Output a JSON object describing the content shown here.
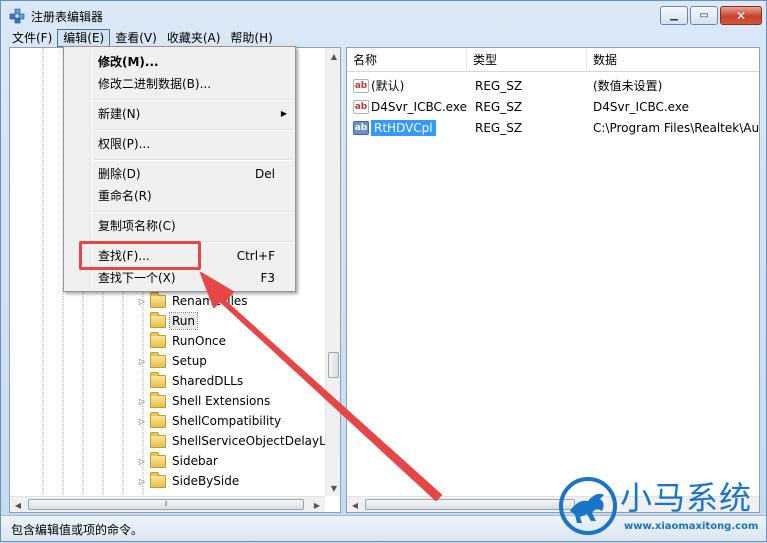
{
  "window": {
    "title": "注册表编辑器",
    "min_icon": "minimize-icon",
    "max_icon": "maximize-icon",
    "close_icon": "close-icon"
  },
  "menubar": {
    "items": [
      {
        "label": "文件(F)"
      },
      {
        "label": "编辑(E)"
      },
      {
        "label": "查看(V)"
      },
      {
        "label": "收藏夹(A)"
      },
      {
        "label": "帮助(H)"
      }
    ]
  },
  "edit_menu": {
    "modify": "修改(M)...",
    "modify_binary": "修改二进制数据(B)...",
    "new": "新建(N)",
    "permissions": "权限(P)...",
    "delete": "删除(D)",
    "delete_shortcut": "Del",
    "rename": "重命名(R)",
    "copy_key_name": "复制项名称(C)",
    "find": "查找(F)...",
    "find_shortcut": "Ctrl+F",
    "find_next": "查找下一个(X)",
    "find_next_shortcut": "F3"
  },
  "tree": {
    "items": [
      {
        "label": "RenameFiles"
      },
      {
        "label": "Run"
      },
      {
        "label": "RunOnce"
      },
      {
        "label": "Setup"
      },
      {
        "label": "SharedDLLs"
      },
      {
        "label": "Shell Extensions"
      },
      {
        "label": "ShellCompatibility"
      },
      {
        "label": "ShellServiceObjectDelayLoad"
      },
      {
        "label": "Sidebar"
      },
      {
        "label": "SideBySide"
      }
    ],
    "selected": "Run"
  },
  "values": {
    "columns": [
      "名称",
      "类型",
      "数据"
    ],
    "rows": [
      {
        "name": "(默认)",
        "type": "REG_SZ",
        "data": "(数值未设置)"
      },
      {
        "name": "D4Svr_ICBC.exe",
        "type": "REG_SZ",
        "data": "D4Svr_ICBC.exe"
      },
      {
        "name": "RtHDVCpl",
        "type": "REG_SZ",
        "data": "C:\\Program Files\\Realtek\\Audio"
      }
    ],
    "selected": "RtHDVCpl"
  },
  "statusbar": {
    "text": "包含编辑值或项的命令。"
  },
  "watermark": {
    "brand": "小马系统",
    "url": "www.xiaomaxitong.com"
  },
  "colors": {
    "highlight_box": "#e64646",
    "selection": "#3399ff",
    "watermark_blue": "#1a74c7"
  }
}
